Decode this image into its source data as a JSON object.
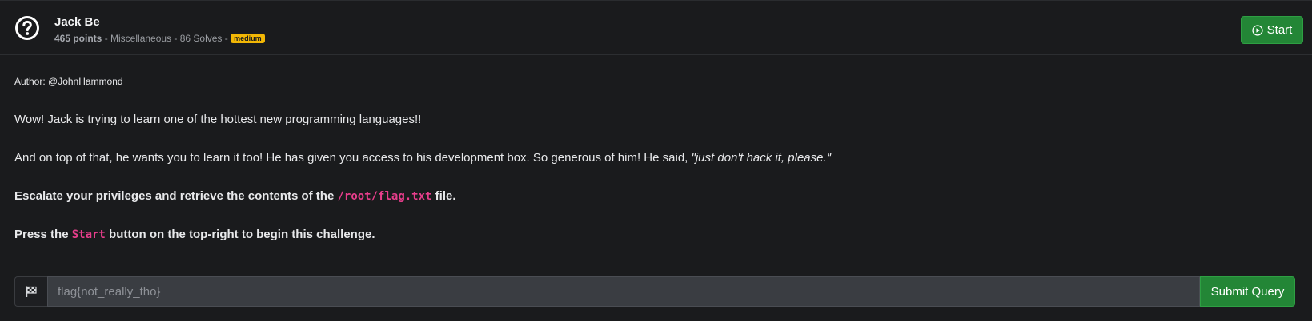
{
  "challenge": {
    "title": "Jack Be",
    "points": "465 points",
    "category_text": " - Miscellaneous - 86 Solves - ",
    "difficulty": "medium",
    "start_label": "Start"
  },
  "description": {
    "author": "Author: @JohnHammond",
    "para1": "Wow! Jack is trying to learn one of the hottest new programming languages!!",
    "para2_text": "And on top of that, he wants you to learn it too! He has given you access to his development box. So generous of him! He said, ",
    "para2_quote": "\"just don't hack it, please.\"",
    "para3_before": "Escalate your privileges and retrieve the contents of the ",
    "para3_code": "/root/flag.txt",
    "para3_after": " file.",
    "para4_before": "Press the ",
    "para4_code": "Start",
    "para4_after": " button on the top-right to begin this challenge."
  },
  "flag_form": {
    "placeholder": "flag{not_really_tho}",
    "value": "",
    "submit_label": "Submit Query"
  },
  "colors": {
    "accent_green": "#238636",
    "badge_yellow": "#f2b705",
    "code_pink": "#e83e8c"
  },
  "icons": {
    "header": "question-circle-icon",
    "start": "play-circle-icon",
    "flag": "checkered-flag-icon"
  }
}
